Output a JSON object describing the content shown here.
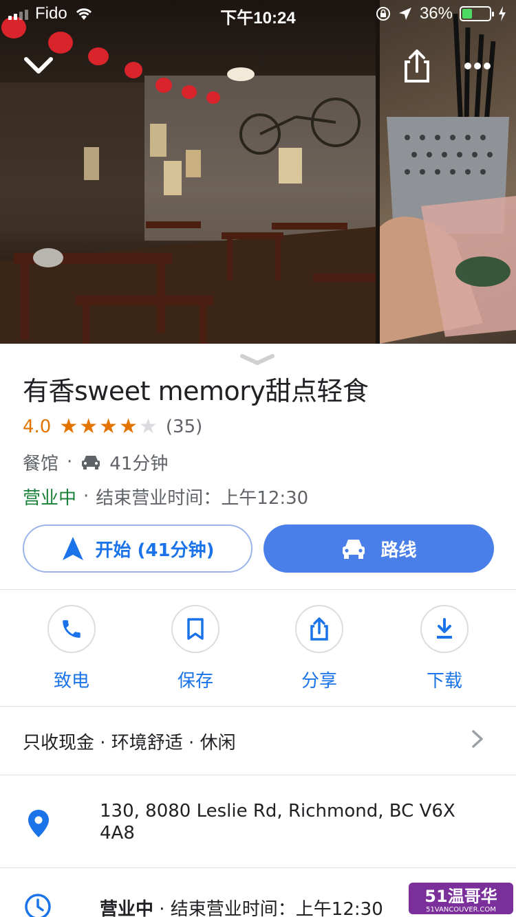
{
  "status_bar": {
    "carrier": "Fido",
    "time": "下午10:24",
    "battery": "36%"
  },
  "photo_section": {
    "icons": [
      "chevron-down-icon",
      "share-icon",
      "more-icon"
    ]
  },
  "place": {
    "name": "有香sweet memory甜点轻食",
    "rating": "4.0",
    "stars": 4,
    "max_stars": 5,
    "reviews": "(35)",
    "category": "餐馆",
    "separator": "·",
    "drive_time": "41分钟",
    "open_status": "营业中",
    "closing_text": "结束营业时间：上午12:30",
    "accent_color": "#1a73e8",
    "open_color": "#188038",
    "rating_color": "#e37400"
  },
  "buttons": {
    "start": "开始 (41分钟)",
    "route": "路线"
  },
  "actions": [
    {
      "label": "致电",
      "icon": "phone-icon"
    },
    {
      "label": "保存",
      "icon": "bookmark-icon"
    },
    {
      "label": "分享",
      "icon": "share-icon"
    },
    {
      "label": "下载",
      "icon": "download-icon"
    }
  ],
  "attributes": "只收现金 · 环境舒适 · 休闲",
  "address": "130, 8080 Leslie Rd, Richmond, BC V6X 4A8",
  "hours_row": {
    "status": "营业中",
    "rest": " · 结束营业时间：上午12:30"
  },
  "watermark": {
    "main": "51温哥华",
    "sub": "51VANCOUVER.COM"
  }
}
